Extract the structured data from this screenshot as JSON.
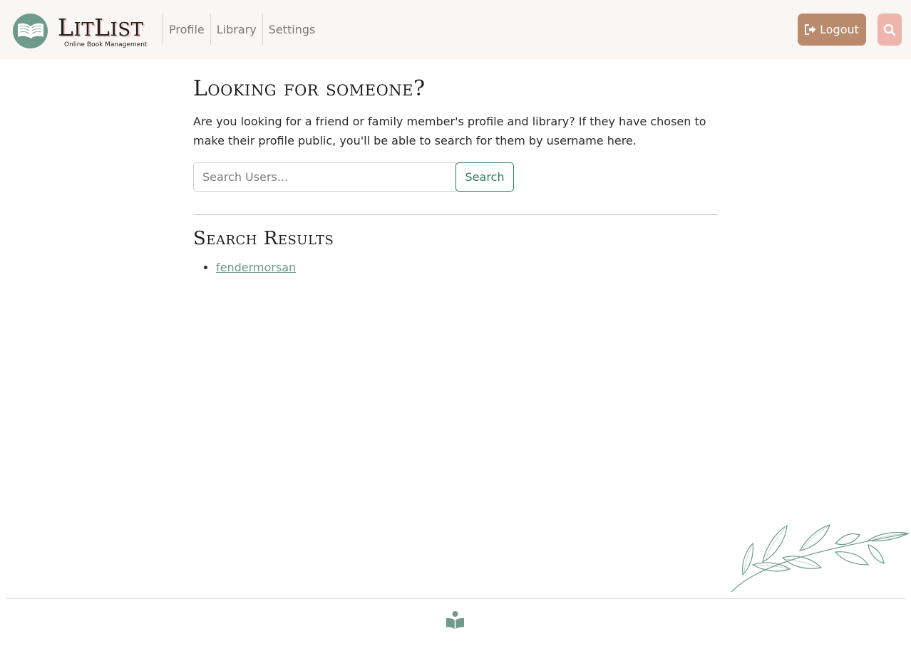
{
  "header": {
    "brand": {
      "title_first": "L",
      "title_first_rest": "IT",
      "title_second": "L",
      "title_second_rest": "IST",
      "subtitle": "Online Book Management"
    },
    "nav": [
      {
        "label": "Profile"
      },
      {
        "label": "Library"
      },
      {
        "label": "Settings"
      }
    ],
    "logout_label": "Logout"
  },
  "main": {
    "title": "Looking for someone?",
    "intro": "Are you looking for a friend or family member's profile and library? If they have chosen to make their profile public, you'll be able to search for them by username here.",
    "search": {
      "placeholder": "Search Users...",
      "value": "",
      "button_label": "Search"
    },
    "results_title": "Search Results",
    "results": [
      {
        "username": "fendermorsan"
      }
    ]
  },
  "colors": {
    "accent_green": "#6e9a8b",
    "logout": "#b98b6c",
    "search_toggle": "#efb5ad",
    "header_bg": "#faf6f3"
  },
  "icons": {
    "brand": "open-book-icon",
    "logout": "sign-out-icon",
    "search": "search-icon",
    "footer": "reader-icon",
    "decoration": "leaf-branch-icon"
  }
}
